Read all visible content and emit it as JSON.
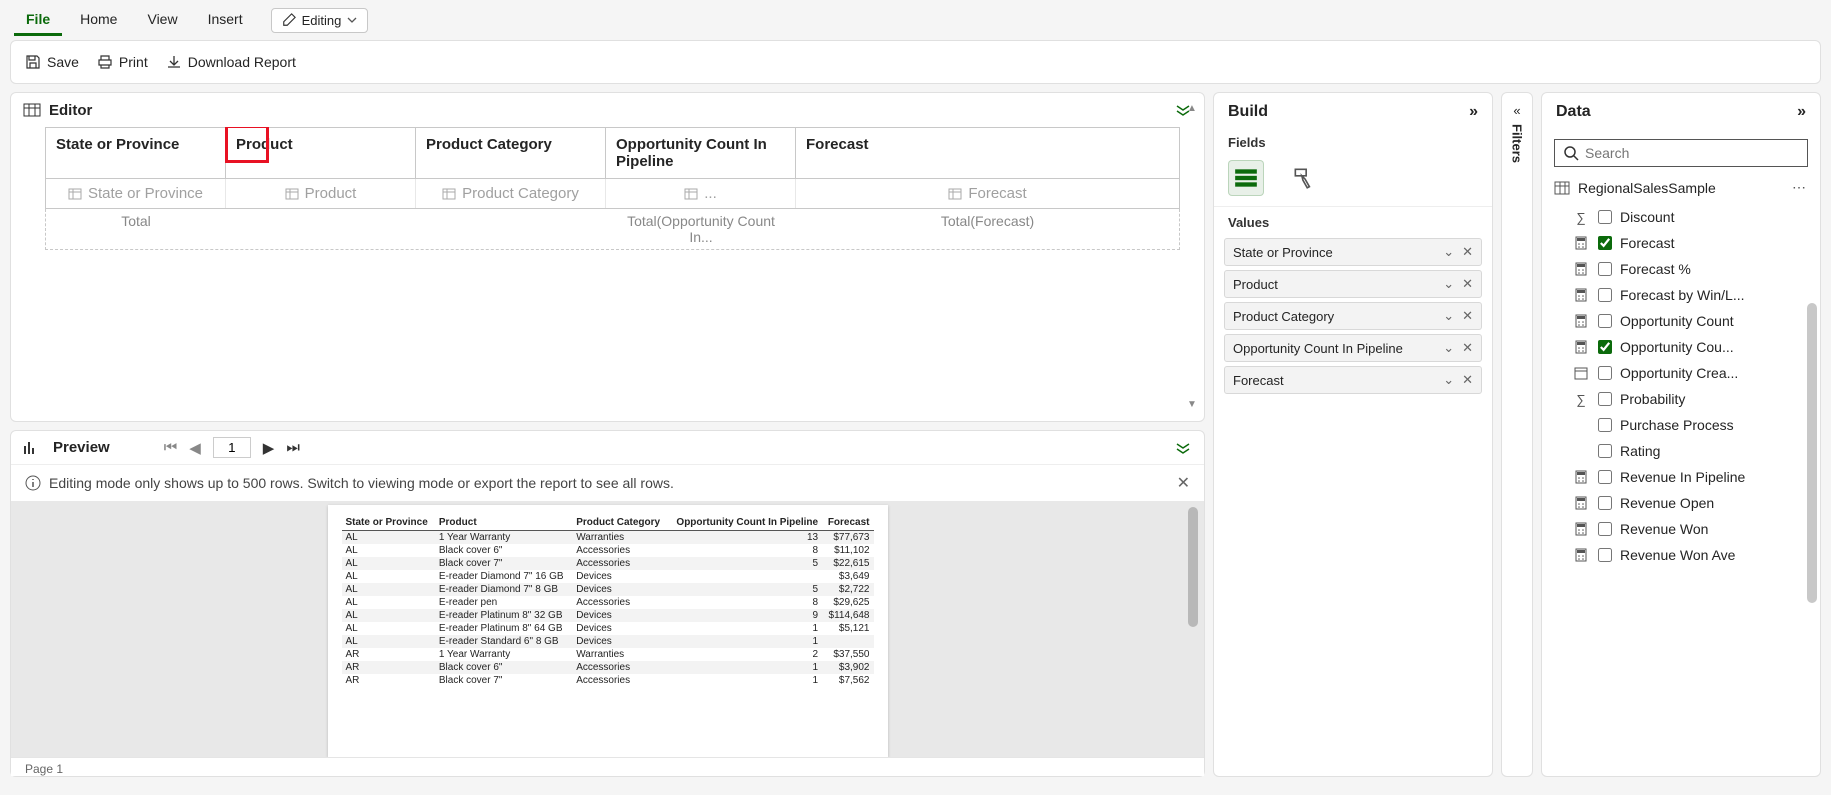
{
  "menu": {
    "file": "File",
    "home": "Home",
    "view": "View",
    "insert": "Insert",
    "editing": "Editing"
  },
  "toolbar": {
    "save": "Save",
    "print": "Print",
    "download": "Download Report"
  },
  "editor": {
    "title": "Editor",
    "headers": [
      "State or Province",
      "Product",
      "Product Category",
      "Opportunity Count In Pipeline",
      "Forecast"
    ],
    "placeholders": [
      "State or Province",
      "Product",
      "Product Category",
      "...",
      "Forecast"
    ],
    "total_label": "Total",
    "total3": "Total(Opportunity Count In...",
    "total4": "Total(Forecast)"
  },
  "preview": {
    "title": "Preview",
    "page": "1",
    "info": "Editing mode only shows up to 500 rows. Switch to viewing mode or export the report to see all rows.",
    "headers": [
      "State or Province",
      "Product",
      "Product Category",
      "Opportunity Count In Pipeline",
      "Forecast"
    ],
    "rows": [
      [
        "AL",
        "1 Year Warranty",
        "Warranties",
        "13",
        "$77,673"
      ],
      [
        "AL",
        "Black cover 6\"",
        "Accessories",
        "8",
        "$11,102"
      ],
      [
        "AL",
        "Black cover 7\"",
        "Accessories",
        "5",
        "$22,615"
      ],
      [
        "AL",
        "E-reader Diamond 7\" 16 GB",
        "Devices",
        "",
        "$3,649"
      ],
      [
        "AL",
        "E-reader Diamond 7\" 8 GB",
        "Devices",
        "5",
        "$2,722"
      ],
      [
        "AL",
        "E-reader pen",
        "Accessories",
        "8",
        "$29,625"
      ],
      [
        "AL",
        "E-reader Platinum 8\" 32 GB",
        "Devices",
        "9",
        "$114,648"
      ],
      [
        "AL",
        "E-reader Platinum 8\" 64 GB",
        "Devices",
        "1",
        "$5,121"
      ],
      [
        "AL",
        "E-reader Standard 6\" 8 GB",
        "Devices",
        "1",
        ""
      ],
      [
        "AR",
        "1 Year Warranty",
        "Warranties",
        "2",
        "$37,550"
      ],
      [
        "AR",
        "Black cover 6\"",
        "Accessories",
        "1",
        "$3,902"
      ],
      [
        "AR",
        "Black cover 7\"",
        "Accessories",
        "1",
        "$7,562"
      ]
    ],
    "page_footer": "Page 1"
  },
  "build": {
    "title": "Build",
    "fields_label": "Fields",
    "values_label": "Values",
    "values": [
      "State or Province",
      "Product",
      "Product Category",
      "Opportunity Count In Pipeline",
      "Forecast"
    ]
  },
  "filters": {
    "label": "Filters"
  },
  "data": {
    "title": "Data",
    "search_placeholder": "Search",
    "table": "RegionalSalesSample",
    "fields": [
      {
        "icon": "sigma",
        "checked": false,
        "label": "Discount"
      },
      {
        "icon": "calc",
        "checked": true,
        "label": "Forecast"
      },
      {
        "icon": "calc",
        "checked": false,
        "label": "Forecast %"
      },
      {
        "icon": "calc",
        "checked": false,
        "label": "Forecast by Win/L..."
      },
      {
        "icon": "calc",
        "checked": false,
        "label": "Opportunity Count"
      },
      {
        "icon": "calc",
        "checked": true,
        "label": "Opportunity Cou..."
      },
      {
        "icon": "cal",
        "checked": false,
        "label": "Opportunity Crea..."
      },
      {
        "icon": "sigma",
        "checked": false,
        "label": "Probability"
      },
      {
        "icon": "none",
        "checked": false,
        "label": "Purchase Process"
      },
      {
        "icon": "none",
        "checked": false,
        "label": "Rating"
      },
      {
        "icon": "calc",
        "checked": false,
        "label": "Revenue In Pipeline"
      },
      {
        "icon": "calc",
        "checked": false,
        "label": "Revenue Open"
      },
      {
        "icon": "calc",
        "checked": false,
        "label": "Revenue Won"
      },
      {
        "icon": "calc",
        "checked": false,
        "label": "Revenue Won Ave"
      }
    ]
  }
}
